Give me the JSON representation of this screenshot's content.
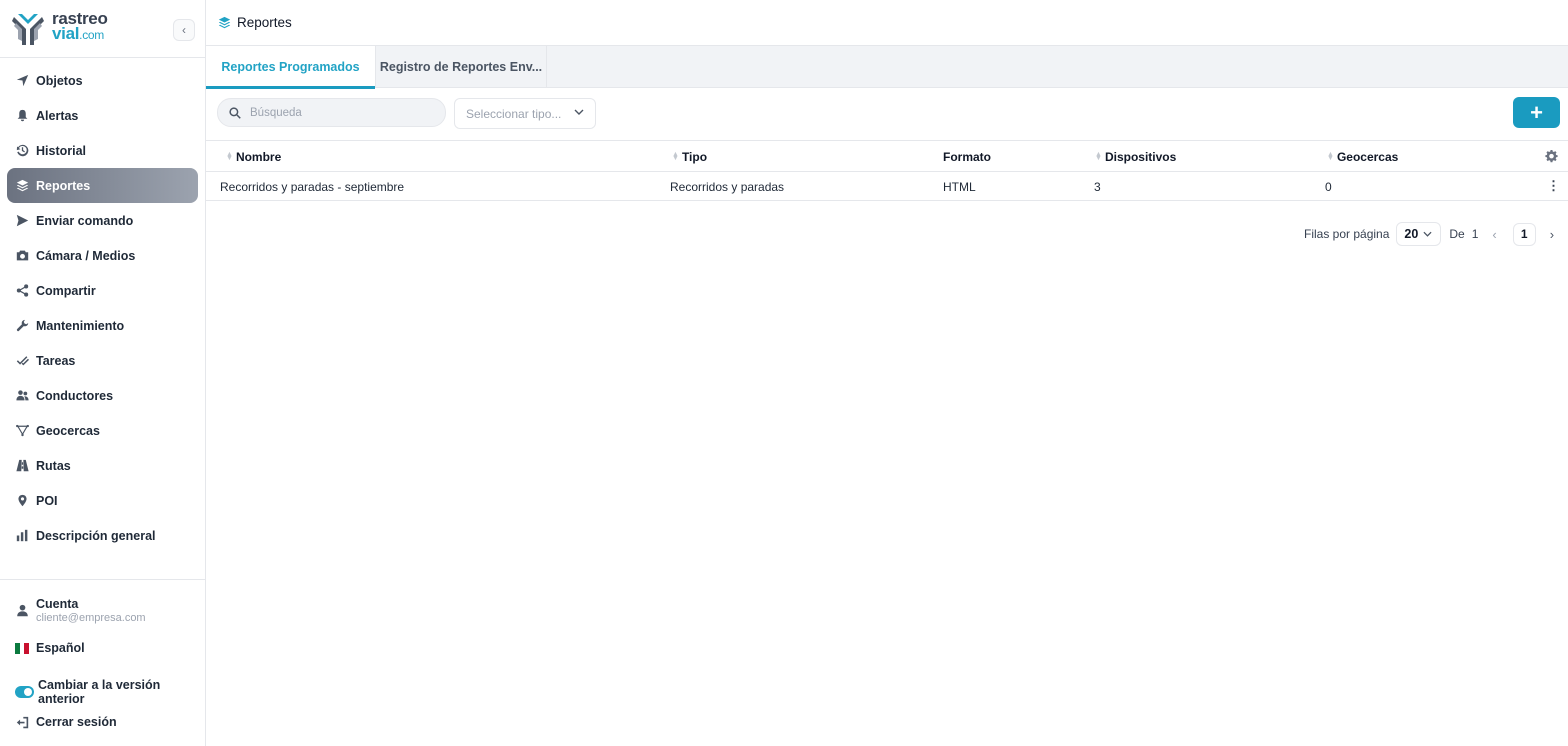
{
  "brand": {
    "line1": "rastreo",
    "line2": "vial",
    "line2_suffix": ".com",
    "collapse_glyph": "‹"
  },
  "nav": {
    "items": [
      {
        "label": "Objetos",
        "icon": "navigation-arrow-icon"
      },
      {
        "label": "Alertas",
        "icon": "bell-icon"
      },
      {
        "label": "Historial",
        "icon": "history-icon"
      },
      {
        "label": "Reportes",
        "icon": "layers-icon",
        "active": true
      },
      {
        "label": "Enviar comando",
        "icon": "send-icon"
      },
      {
        "label": "Cámara / Medios",
        "icon": "camera-icon"
      },
      {
        "label": "Compartir",
        "icon": "share-icon"
      },
      {
        "label": "Mantenimiento",
        "icon": "wrench-icon"
      },
      {
        "label": "Tareas",
        "icon": "double-check-icon"
      },
      {
        "label": "Conductores",
        "icon": "users-icon"
      },
      {
        "label": "Geocercas",
        "icon": "polygon-icon"
      },
      {
        "label": "Rutas",
        "icon": "road-icon"
      },
      {
        "label": "POI",
        "icon": "map-pin-icon"
      },
      {
        "label": "Descripción general",
        "icon": "bar-chart-icon"
      }
    ]
  },
  "account": {
    "label": "Cuenta",
    "email": "cliente@empresa.com"
  },
  "language": {
    "label": "Español"
  },
  "legacy_toggle": {
    "label": "Cambiar a la versión anterior"
  },
  "logout": {
    "label": "Cerrar sesión"
  },
  "header": {
    "title": "Reportes"
  },
  "tabs": [
    {
      "label": "Reportes Programados",
      "active": true
    },
    {
      "label": "Registro de Reportes Env..."
    }
  ],
  "toolbar": {
    "search_placeholder": "Búsqueda",
    "type_placeholder": "Seleccionar tipo...",
    "add_label": "+"
  },
  "table": {
    "columns": [
      "Nombre",
      "Tipo",
      "Formato",
      "Dispositivos",
      "Geocercas"
    ],
    "rows": [
      {
        "nombre": "Recorridos y paradas - septiembre",
        "tipo": "Recorridos y paradas",
        "formato": "HTML",
        "dispositivos": "3",
        "geocercas": "0"
      }
    ]
  },
  "pagination": {
    "rows_label": "Filas por página",
    "rows_per_page": "20",
    "of_label": "De",
    "total_pages": "1",
    "current_page": "1"
  },
  "colors": {
    "accent": "#1a9bc0",
    "active_nav": "#7b8290"
  }
}
